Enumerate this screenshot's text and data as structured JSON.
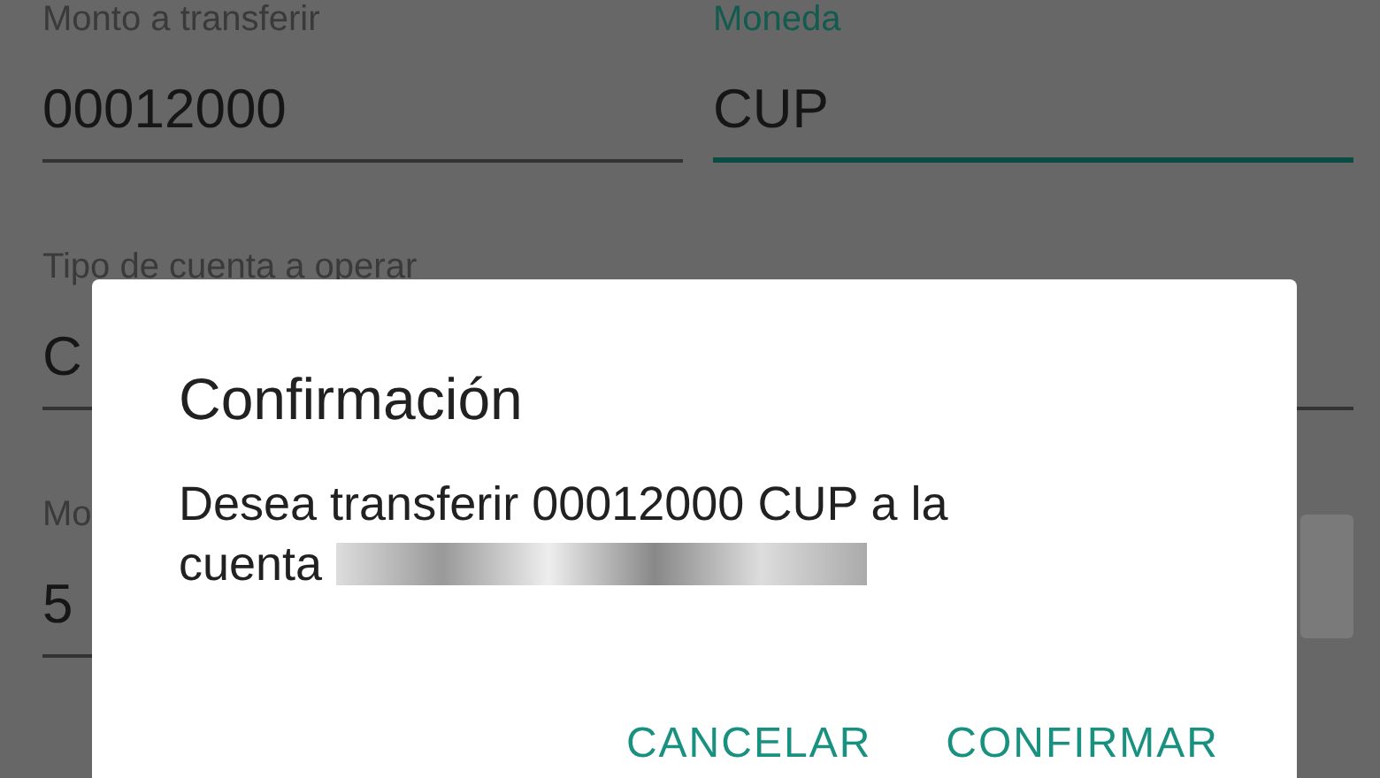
{
  "form": {
    "rows": [
      [
        {
          "kind": "text",
          "label": "Monto a transferir",
          "value": "00012000",
          "focused": false
        },
        {
          "kind": "text",
          "label": "Moneda",
          "value": "CUP",
          "focused": true
        }
      ],
      [
        {
          "kind": "text",
          "label": "Tipo de cuenta a operar",
          "value": "C",
          "focused": false
        }
      ],
      [
        {
          "kind": "contact",
          "label": "Mo",
          "value": "5",
          "focused": false
        }
      ]
    ]
  },
  "dialog": {
    "title": "Confirmación",
    "message": "Desea transferir 00012000 CUP a la cuenta",
    "redacted": true,
    "buttons": [
      "CANCELAR",
      "CONFIRMAR"
    ]
  }
}
